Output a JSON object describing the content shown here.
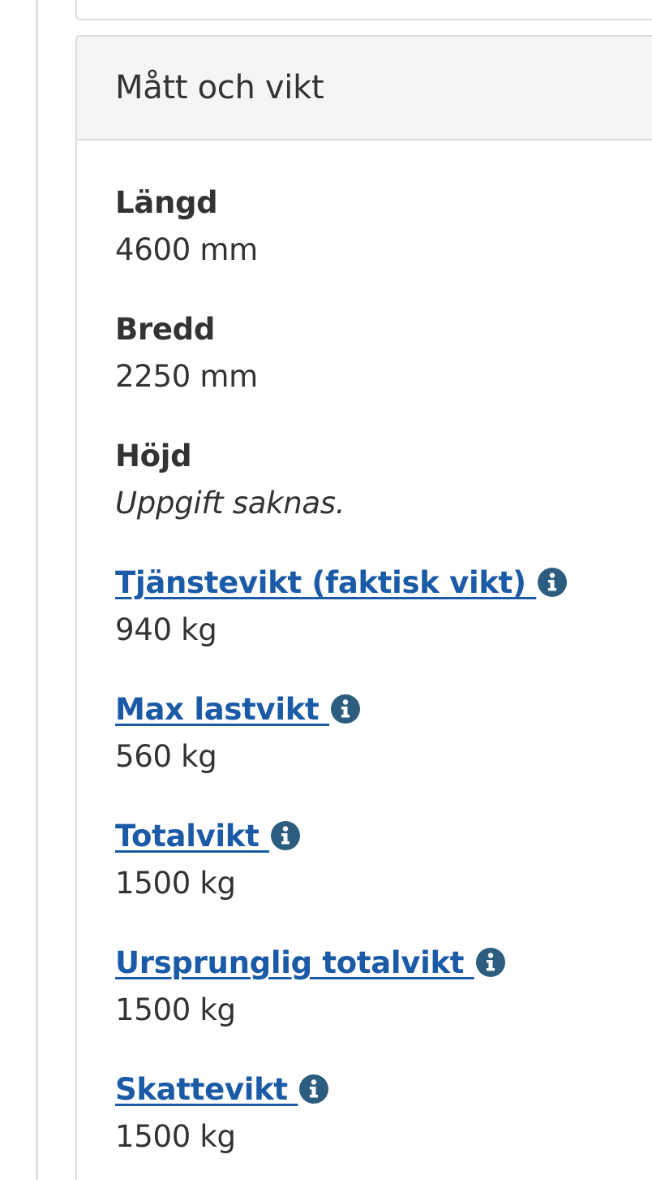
{
  "section": {
    "title": "Mått och vikt"
  },
  "fields": {
    "length": {
      "label": "Längd",
      "value": "4600 mm"
    },
    "width": {
      "label": "Bredd",
      "value": "2250 mm"
    },
    "height": {
      "label": "Höjd",
      "value": "Uppgift saknas."
    },
    "curb_weight": {
      "label": "Tjänstevikt (faktisk vikt) ",
      "value": "940 kg"
    },
    "max_load": {
      "label": "Max lastvikt ",
      "value": "560 kg"
    },
    "total_weight": {
      "label": "Totalvikt ",
      "value": "1500 kg"
    },
    "original_total_weight": {
      "label": "Ursprunglig totalvikt ",
      "value": "1500 kg"
    },
    "tax_weight": {
      "label": "Skattevikt ",
      "value": "1500 kg"
    }
  },
  "icons": {
    "info": "info-circle-icon"
  },
  "colors": {
    "link": "#1a5aa6",
    "info_icon": "#2c5d7f",
    "text": "#333333",
    "header_bg": "#f5f5f5",
    "border": "#dcdcdc"
  }
}
